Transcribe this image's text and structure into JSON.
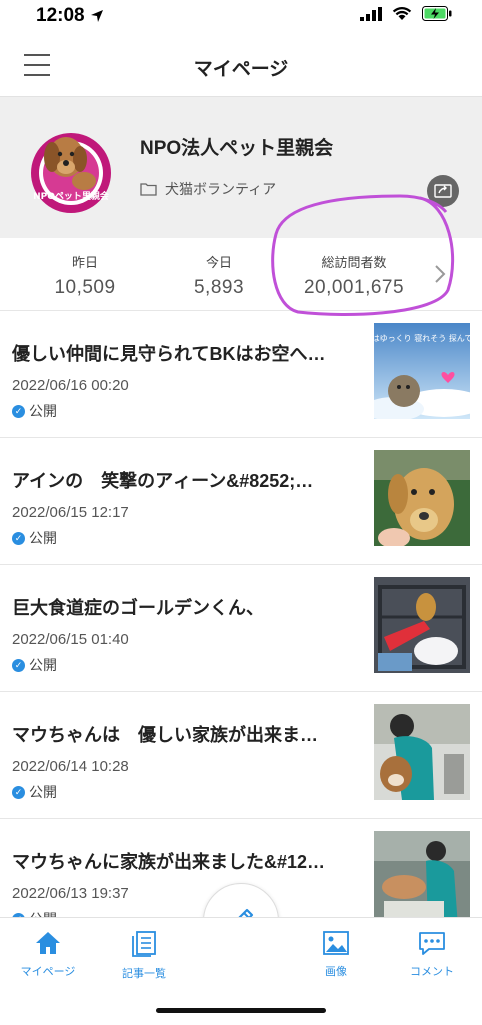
{
  "status_bar": {
    "time": "12:08"
  },
  "header": {
    "title": "マイページ"
  },
  "profile": {
    "name": "NPO法人ペット里親会",
    "category": "犬猫ボランティア",
    "logo_text": "NPOペット里親会"
  },
  "stats": [
    {
      "label": "昨日",
      "value": "10,509"
    },
    {
      "label": "今日",
      "value": "5,893"
    },
    {
      "label": "総訪問者数",
      "value": "20,001,675"
    }
  ],
  "articles": [
    {
      "title": "優しい仲間に見守られてBKはお空へ…",
      "date": "2022/06/16 00:20",
      "status": "公開",
      "thumb_text": "雲の上はゆっくり 寝れそう 探んで有難う"
    },
    {
      "title": "アインの　笑撃のアィーン&#8252;…",
      "date": "2022/06/15 12:17",
      "status": "公開"
    },
    {
      "title": "巨大食道症のゴールデンくん、",
      "date": "2022/06/15 01:40",
      "status": "公開"
    },
    {
      "title": "マウちゃんは　優しい家族が出来ま…",
      "date": "2022/06/14 10:28",
      "status": "公開"
    },
    {
      "title": "マウちゃんに家族が出来ました&#12…",
      "date": "2022/06/13 19:37",
      "status": "公開"
    }
  ],
  "tabs": [
    {
      "label": "マイページ",
      "icon": "home-icon"
    },
    {
      "label": "記事一覧",
      "icon": "article-list-icon"
    },
    {
      "label": "画像",
      "icon": "image-icon"
    },
    {
      "label": "コメント",
      "icon": "comment-icon"
    }
  ],
  "colors": {
    "accent": "#2a8ee0",
    "annotation": "#c050d8"
  }
}
